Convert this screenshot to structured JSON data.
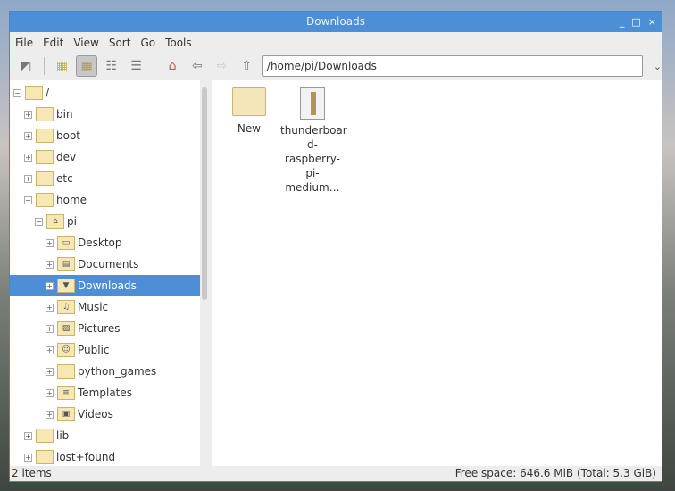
{
  "window": {
    "title": "Downloads",
    "controls": [
      "_",
      "□",
      "×"
    ]
  },
  "menu": [
    "File",
    "Edit",
    "View",
    "Sort",
    "Go",
    "Tools"
  ],
  "toolbar": {
    "path": "/home/pi/Downloads"
  },
  "tree": [
    {
      "label": "/",
      "level": 0,
      "exp": "−"
    },
    {
      "label": "bin",
      "level": 1,
      "exp": "+"
    },
    {
      "label": "boot",
      "level": 1,
      "exp": "+"
    },
    {
      "label": "dev",
      "level": 1,
      "exp": "+"
    },
    {
      "label": "etc",
      "level": 1,
      "exp": "+"
    },
    {
      "label": "home",
      "level": 1,
      "exp": "−"
    },
    {
      "label": "pi",
      "level": 2,
      "exp": "−",
      "glyph": "⌂"
    },
    {
      "label": "Desktop",
      "level": 3,
      "exp": "+",
      "glyph": "▭"
    },
    {
      "label": "Documents",
      "level": 3,
      "exp": "+",
      "glyph": "▤"
    },
    {
      "label": "Downloads",
      "level": 3,
      "exp": "+",
      "glyph": "▼",
      "selected": true
    },
    {
      "label": "Music",
      "level": 3,
      "exp": "+",
      "glyph": "♫"
    },
    {
      "label": "Pictures",
      "level": 3,
      "exp": "+",
      "glyph": "▨"
    },
    {
      "label": "Public",
      "level": 3,
      "exp": "+",
      "glyph": "☺"
    },
    {
      "label": "python_games",
      "level": 3,
      "exp": "+"
    },
    {
      "label": "Templates",
      "level": 3,
      "exp": "+",
      "glyph": "≡"
    },
    {
      "label": "Videos",
      "level": 3,
      "exp": "+",
      "glyph": "▣"
    },
    {
      "label": "lib",
      "level": 1,
      "exp": "+"
    },
    {
      "label": "lost+found",
      "level": 1,
      "exp": "+"
    }
  ],
  "files": [
    {
      "name": "New",
      "type": "folder"
    },
    {
      "name": "thunderboar d-raspberry-pi-medium…",
      "type": "archive"
    }
  ],
  "status": {
    "count": "2 items",
    "free": "Free space: 646.6 MiB (Total: 5.3 GiB)"
  }
}
